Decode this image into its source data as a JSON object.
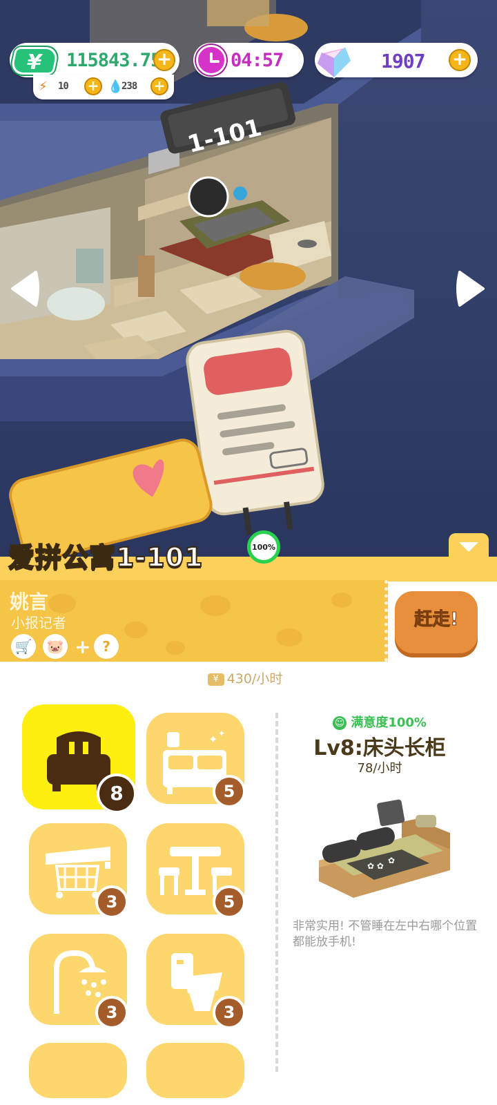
{
  "hud": {
    "money_symbol": "¥",
    "money": "115843.75",
    "energy": "10",
    "water": "238",
    "timer": "04:57",
    "gems": "1907",
    "plus": "+"
  },
  "room_sign": "1-101",
  "apartment": {
    "title": "爱拼公寓1-101",
    "occupancy": "100%",
    "tenant_name": "姚言",
    "tenant_role": "小报记者",
    "trait_plus": "+",
    "evict_label": "赶走!",
    "income": "430/小时"
  },
  "categories": [
    {
      "name": "bed",
      "level": "8",
      "selected": true
    },
    {
      "name": "cabinet",
      "level": "5"
    },
    {
      "name": "bathtub",
      "level": "3"
    },
    {
      "name": "table",
      "level": "5"
    },
    {
      "name": "shower",
      "level": "3"
    },
    {
      "name": "toilet",
      "level": "3"
    }
  ],
  "detail": {
    "satisfaction": "满意度100%",
    "title": "Lv8:床头长柜",
    "rate": "78/小时",
    "description": "非常实用! 不管睡在左中右哪个位置都能放手机!"
  },
  "colors": {
    "yellow_band": "#fbd15c",
    "selected": "#ffef10",
    "money_green": "#2fa86e",
    "timer_magenta": "#c42dbd",
    "gem_purple": "#6e3fc0"
  }
}
